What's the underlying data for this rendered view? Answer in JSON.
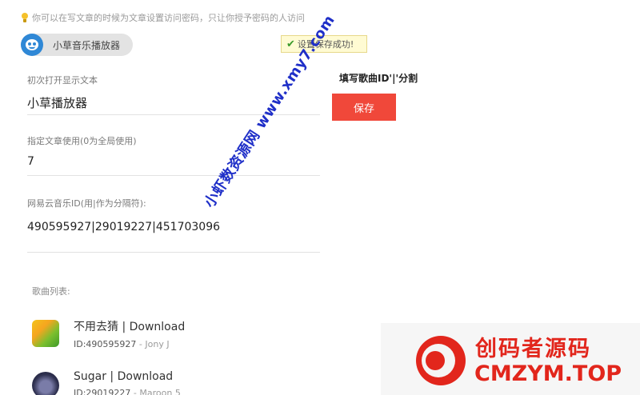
{
  "hint": {
    "icon": "lightbulb-icon",
    "text": "你可以在写文章的时候为文章设置访问密码，只让你授予密码的人访问"
  },
  "app": {
    "name": "小草音乐播放器",
    "logo_color": "#2f88d6"
  },
  "toast": {
    "text": "设置保存成功!"
  },
  "form": {
    "intro_label": "初次打开显示文本",
    "intro_value": "小草播放器",
    "post_label": "指定文章使用(0为全局使用)",
    "post_value": "7",
    "ids_label": "网易云音乐ID(用|作为分隔符):",
    "ids_value": "490595927|29019227|451703096"
  },
  "side_note": "填写歌曲ID'|'分割",
  "save_label": "保存",
  "songs": {
    "title": "歌曲列表:",
    "items": [
      {
        "title": "不用去猜 | Download",
        "id": "ID:490595927",
        "artist": "- Jony J"
      },
      {
        "title": "Sugar | Download",
        "id": "ID:29019227",
        "artist": "- Maroon 5"
      }
    ]
  },
  "watermarks": {
    "diagonal": "小虾数资源网 www.xmy7.com",
    "brand_cn": "创码者源码",
    "brand_en": "CMZYM.TOP"
  },
  "colors": {
    "accent": "#f0483a",
    "watermark": "#e2261c"
  }
}
